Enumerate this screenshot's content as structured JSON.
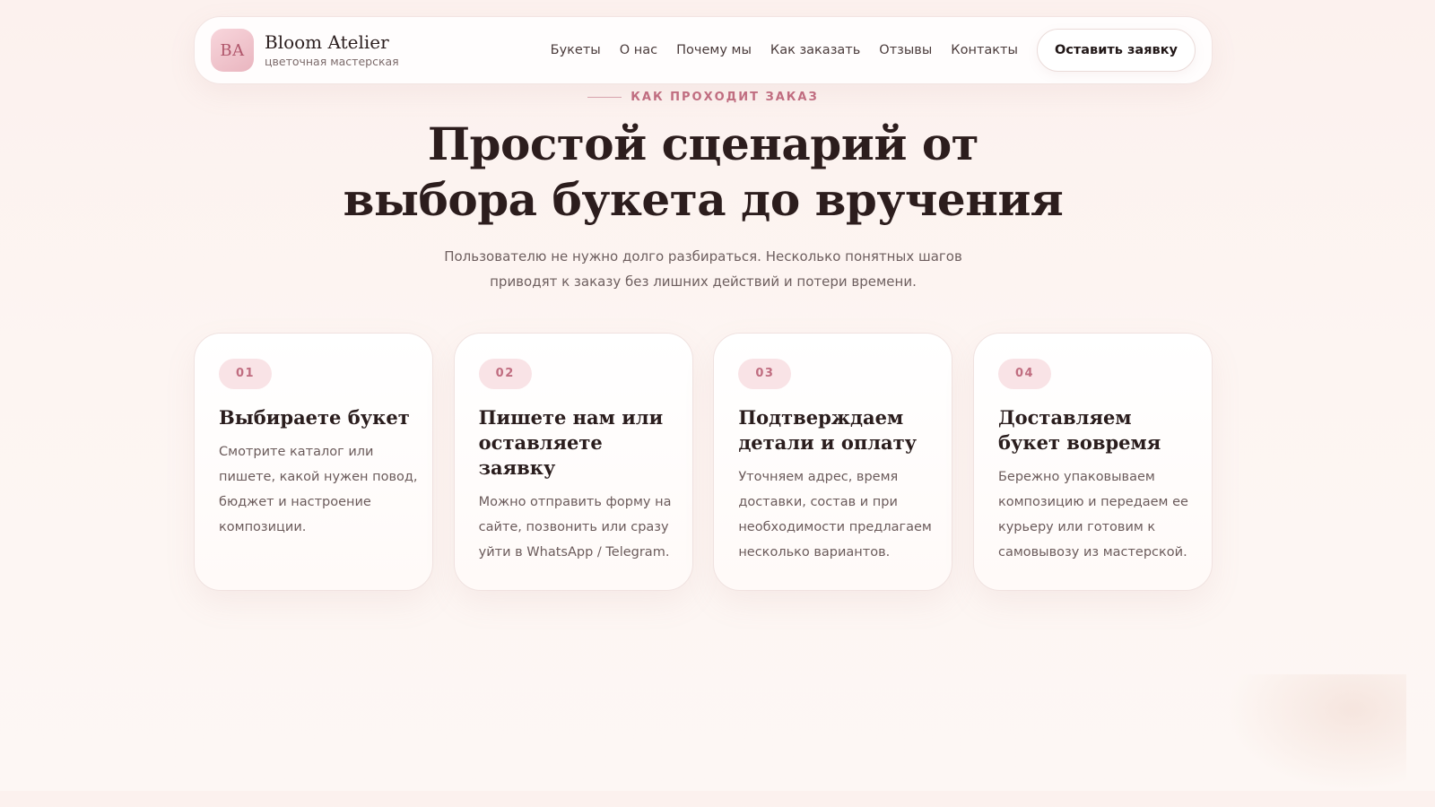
{
  "header": {
    "logo_text": "BA",
    "brand_name": "Bloom Atelier",
    "brand_sub": "цветочная мастерская",
    "nav": [
      "Букеты",
      "О нас",
      "Почему мы",
      "Как заказать",
      "Отзывы",
      "Контакты"
    ],
    "cta_label": "Оставить заявку"
  },
  "hero": {
    "eyebrow": "КАК ПРОХОДИТ ЗАКАЗ",
    "title_lines": [
      "Простой сценарий от",
      "выбора букета до вручения"
    ],
    "lead_lines": [
      "Пользователю не нужно долго разбираться. Несколько понятных шагов",
      "приводят к заказу без лишних действий и потери времени."
    ]
  },
  "steps": [
    {
      "number": "01",
      "title": "Выбираете букет",
      "text": "Смотрите каталог или пишете, какой нужен повод, бюджет и настроение композиции."
    },
    {
      "number": "02",
      "title": "Пишете нам или оставляете заявку",
      "text": "Можно отправить форму на сайте, позвонить или сразу уйти в WhatsApp / Telegram."
    },
    {
      "number": "03",
      "title": "Подтверждаем детали и оплату",
      "text": "Уточняем адрес, время доставки, состав и при необходимости предлагаем несколько вариантов."
    },
    {
      "number": "04",
      "title": "Доставляем букет вовремя",
      "text": "Бережно упаковываем композицию и передаем ее курьеру или готовим к самовывозу из мастерской."
    }
  ],
  "colors": {
    "accent": "#c06d80",
    "badge_bg": "#f9e3e6",
    "page_bg": "#fdf5f2",
    "heading": "#2c1d1d"
  }
}
